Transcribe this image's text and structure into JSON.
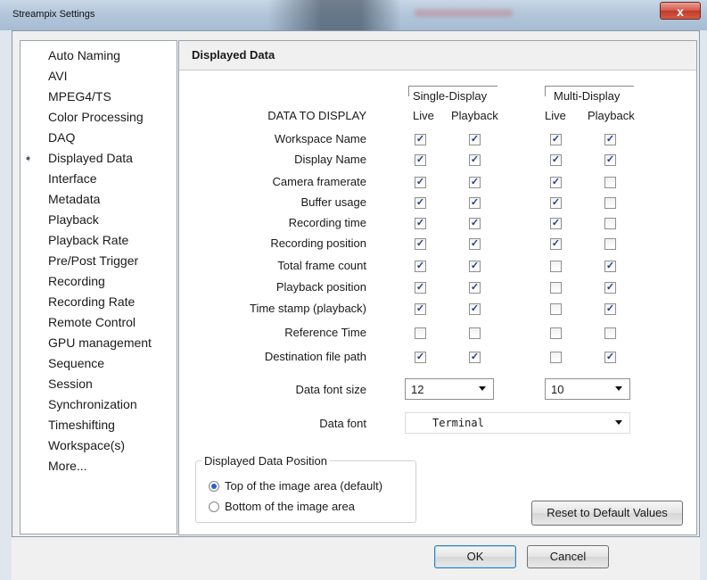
{
  "window": {
    "title": "Streampix Settings",
    "close_symbol": "x"
  },
  "sidebar": {
    "selected_index": 5,
    "items": [
      {
        "label": "Auto Naming"
      },
      {
        "label": "AVI"
      },
      {
        "label": "MPEG4/TS"
      },
      {
        "label": "Color Processing"
      },
      {
        "label": "DAQ"
      },
      {
        "label": "Displayed Data"
      },
      {
        "label": "Interface"
      },
      {
        "label": "Metadata"
      },
      {
        "label": "Playback"
      },
      {
        "label": "Playback Rate"
      },
      {
        "label": "Pre/Post Trigger"
      },
      {
        "label": "Recording"
      },
      {
        "label": "Recording Rate"
      },
      {
        "label": "Remote Control"
      },
      {
        "label": "GPU management"
      },
      {
        "label": "Sequence"
      },
      {
        "label": "Session"
      },
      {
        "label": "Synchronization"
      },
      {
        "label": "Timeshifting"
      },
      {
        "label": "Workspace(s)"
      },
      {
        "label": "More..."
      }
    ]
  },
  "panel": {
    "title": "Displayed Data",
    "groups": {
      "single": "Single-Display",
      "multi": "Multi-Display"
    },
    "columns": {
      "live": "Live",
      "playback": "Playback"
    },
    "data_to_display_label": "DATA TO DISPLAY",
    "rows": [
      {
        "label": "Workspace Name",
        "values": [
          true,
          true,
          true,
          true
        ]
      },
      {
        "label": "Display Name",
        "values": [
          true,
          true,
          true,
          true
        ]
      },
      {
        "label": "Camera framerate",
        "values": [
          true,
          true,
          true,
          false
        ]
      },
      {
        "label": "Buffer usage",
        "values": [
          true,
          true,
          true,
          false
        ]
      },
      {
        "label": "Recording time",
        "values": [
          true,
          true,
          true,
          false
        ]
      },
      {
        "label": "Recording position",
        "values": [
          true,
          true,
          true,
          false
        ]
      },
      {
        "label": "Total frame count",
        "values": [
          true,
          true,
          false,
          true
        ]
      },
      {
        "label": "Playback position",
        "values": [
          true,
          true,
          false,
          true
        ]
      },
      {
        "label": "Time stamp (playback)",
        "values": [
          true,
          true,
          false,
          true
        ]
      },
      {
        "label": "Reference Time",
        "values": [
          false,
          false,
          false,
          false
        ]
      },
      {
        "label": "Destination file path",
        "values": [
          true,
          true,
          false,
          true
        ]
      }
    ],
    "font_size": {
      "label": "Data font size",
      "single": "12",
      "multi": "10"
    },
    "font": {
      "label": "Data font",
      "value": "Terminal"
    },
    "position": {
      "legend": "Displayed Data Position",
      "options": [
        {
          "label": "Top of the image area (default)",
          "selected": true
        },
        {
          "label": "Bottom of the image area",
          "selected": false
        }
      ]
    },
    "reset_label": "Reset to Default Values"
  },
  "footer": {
    "ok_label": "OK",
    "cancel_label": "Cancel"
  },
  "colors": {
    "accent": "#2a62c8",
    "close_red": "#c23a2b"
  }
}
